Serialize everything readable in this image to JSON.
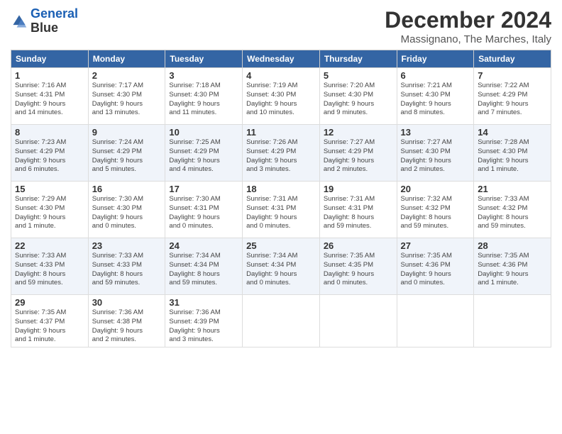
{
  "logo": {
    "line1": "General",
    "line2": "Blue"
  },
  "title": "December 2024",
  "subtitle": "Massignano, The Marches, Italy",
  "days_of_week": [
    "Sunday",
    "Monday",
    "Tuesday",
    "Wednesday",
    "Thursday",
    "Friday",
    "Saturday"
  ],
  "weeks": [
    [
      {
        "day": "1",
        "info": "Sunrise: 7:16 AM\nSunset: 4:31 PM\nDaylight: 9 hours\nand 14 minutes."
      },
      {
        "day": "2",
        "info": "Sunrise: 7:17 AM\nSunset: 4:30 PM\nDaylight: 9 hours\nand 13 minutes."
      },
      {
        "day": "3",
        "info": "Sunrise: 7:18 AM\nSunset: 4:30 PM\nDaylight: 9 hours\nand 11 minutes."
      },
      {
        "day": "4",
        "info": "Sunrise: 7:19 AM\nSunset: 4:30 PM\nDaylight: 9 hours\nand 10 minutes."
      },
      {
        "day": "5",
        "info": "Sunrise: 7:20 AM\nSunset: 4:30 PM\nDaylight: 9 hours\nand 9 minutes."
      },
      {
        "day": "6",
        "info": "Sunrise: 7:21 AM\nSunset: 4:30 PM\nDaylight: 9 hours\nand 8 minutes."
      },
      {
        "day": "7",
        "info": "Sunrise: 7:22 AM\nSunset: 4:29 PM\nDaylight: 9 hours\nand 7 minutes."
      }
    ],
    [
      {
        "day": "8",
        "info": "Sunrise: 7:23 AM\nSunset: 4:29 PM\nDaylight: 9 hours\nand 6 minutes."
      },
      {
        "day": "9",
        "info": "Sunrise: 7:24 AM\nSunset: 4:29 PM\nDaylight: 9 hours\nand 5 minutes."
      },
      {
        "day": "10",
        "info": "Sunrise: 7:25 AM\nSunset: 4:29 PM\nDaylight: 9 hours\nand 4 minutes."
      },
      {
        "day": "11",
        "info": "Sunrise: 7:26 AM\nSunset: 4:29 PM\nDaylight: 9 hours\nand 3 minutes."
      },
      {
        "day": "12",
        "info": "Sunrise: 7:27 AM\nSunset: 4:29 PM\nDaylight: 9 hours\nand 2 minutes."
      },
      {
        "day": "13",
        "info": "Sunrise: 7:27 AM\nSunset: 4:30 PM\nDaylight: 9 hours\nand 2 minutes."
      },
      {
        "day": "14",
        "info": "Sunrise: 7:28 AM\nSunset: 4:30 PM\nDaylight: 9 hours\nand 1 minute."
      }
    ],
    [
      {
        "day": "15",
        "info": "Sunrise: 7:29 AM\nSunset: 4:30 PM\nDaylight: 9 hours\nand 1 minute."
      },
      {
        "day": "16",
        "info": "Sunrise: 7:30 AM\nSunset: 4:30 PM\nDaylight: 9 hours\nand 0 minutes."
      },
      {
        "day": "17",
        "info": "Sunrise: 7:30 AM\nSunset: 4:31 PM\nDaylight: 9 hours\nand 0 minutes."
      },
      {
        "day": "18",
        "info": "Sunrise: 7:31 AM\nSunset: 4:31 PM\nDaylight: 9 hours\nand 0 minutes."
      },
      {
        "day": "19",
        "info": "Sunrise: 7:31 AM\nSunset: 4:31 PM\nDaylight: 8 hours\nand 59 minutes."
      },
      {
        "day": "20",
        "info": "Sunrise: 7:32 AM\nSunset: 4:32 PM\nDaylight: 8 hours\nand 59 minutes."
      },
      {
        "day": "21",
        "info": "Sunrise: 7:33 AM\nSunset: 4:32 PM\nDaylight: 8 hours\nand 59 minutes."
      }
    ],
    [
      {
        "day": "22",
        "info": "Sunrise: 7:33 AM\nSunset: 4:33 PM\nDaylight: 8 hours\nand 59 minutes."
      },
      {
        "day": "23",
        "info": "Sunrise: 7:33 AM\nSunset: 4:33 PM\nDaylight: 8 hours\nand 59 minutes."
      },
      {
        "day": "24",
        "info": "Sunrise: 7:34 AM\nSunset: 4:34 PM\nDaylight: 8 hours\nand 59 minutes."
      },
      {
        "day": "25",
        "info": "Sunrise: 7:34 AM\nSunset: 4:34 PM\nDaylight: 9 hours\nand 0 minutes."
      },
      {
        "day": "26",
        "info": "Sunrise: 7:35 AM\nSunset: 4:35 PM\nDaylight: 9 hours\nand 0 minutes."
      },
      {
        "day": "27",
        "info": "Sunrise: 7:35 AM\nSunset: 4:36 PM\nDaylight: 9 hours\nand 0 minutes."
      },
      {
        "day": "28",
        "info": "Sunrise: 7:35 AM\nSunset: 4:36 PM\nDaylight: 9 hours\nand 1 minute."
      }
    ],
    [
      {
        "day": "29",
        "info": "Sunrise: 7:35 AM\nSunset: 4:37 PM\nDaylight: 9 hours\nand 1 minute."
      },
      {
        "day": "30",
        "info": "Sunrise: 7:36 AM\nSunset: 4:38 PM\nDaylight: 9 hours\nand 2 minutes."
      },
      {
        "day": "31",
        "info": "Sunrise: 7:36 AM\nSunset: 4:39 PM\nDaylight: 9 hours\nand 3 minutes."
      },
      null,
      null,
      null,
      null
    ]
  ]
}
